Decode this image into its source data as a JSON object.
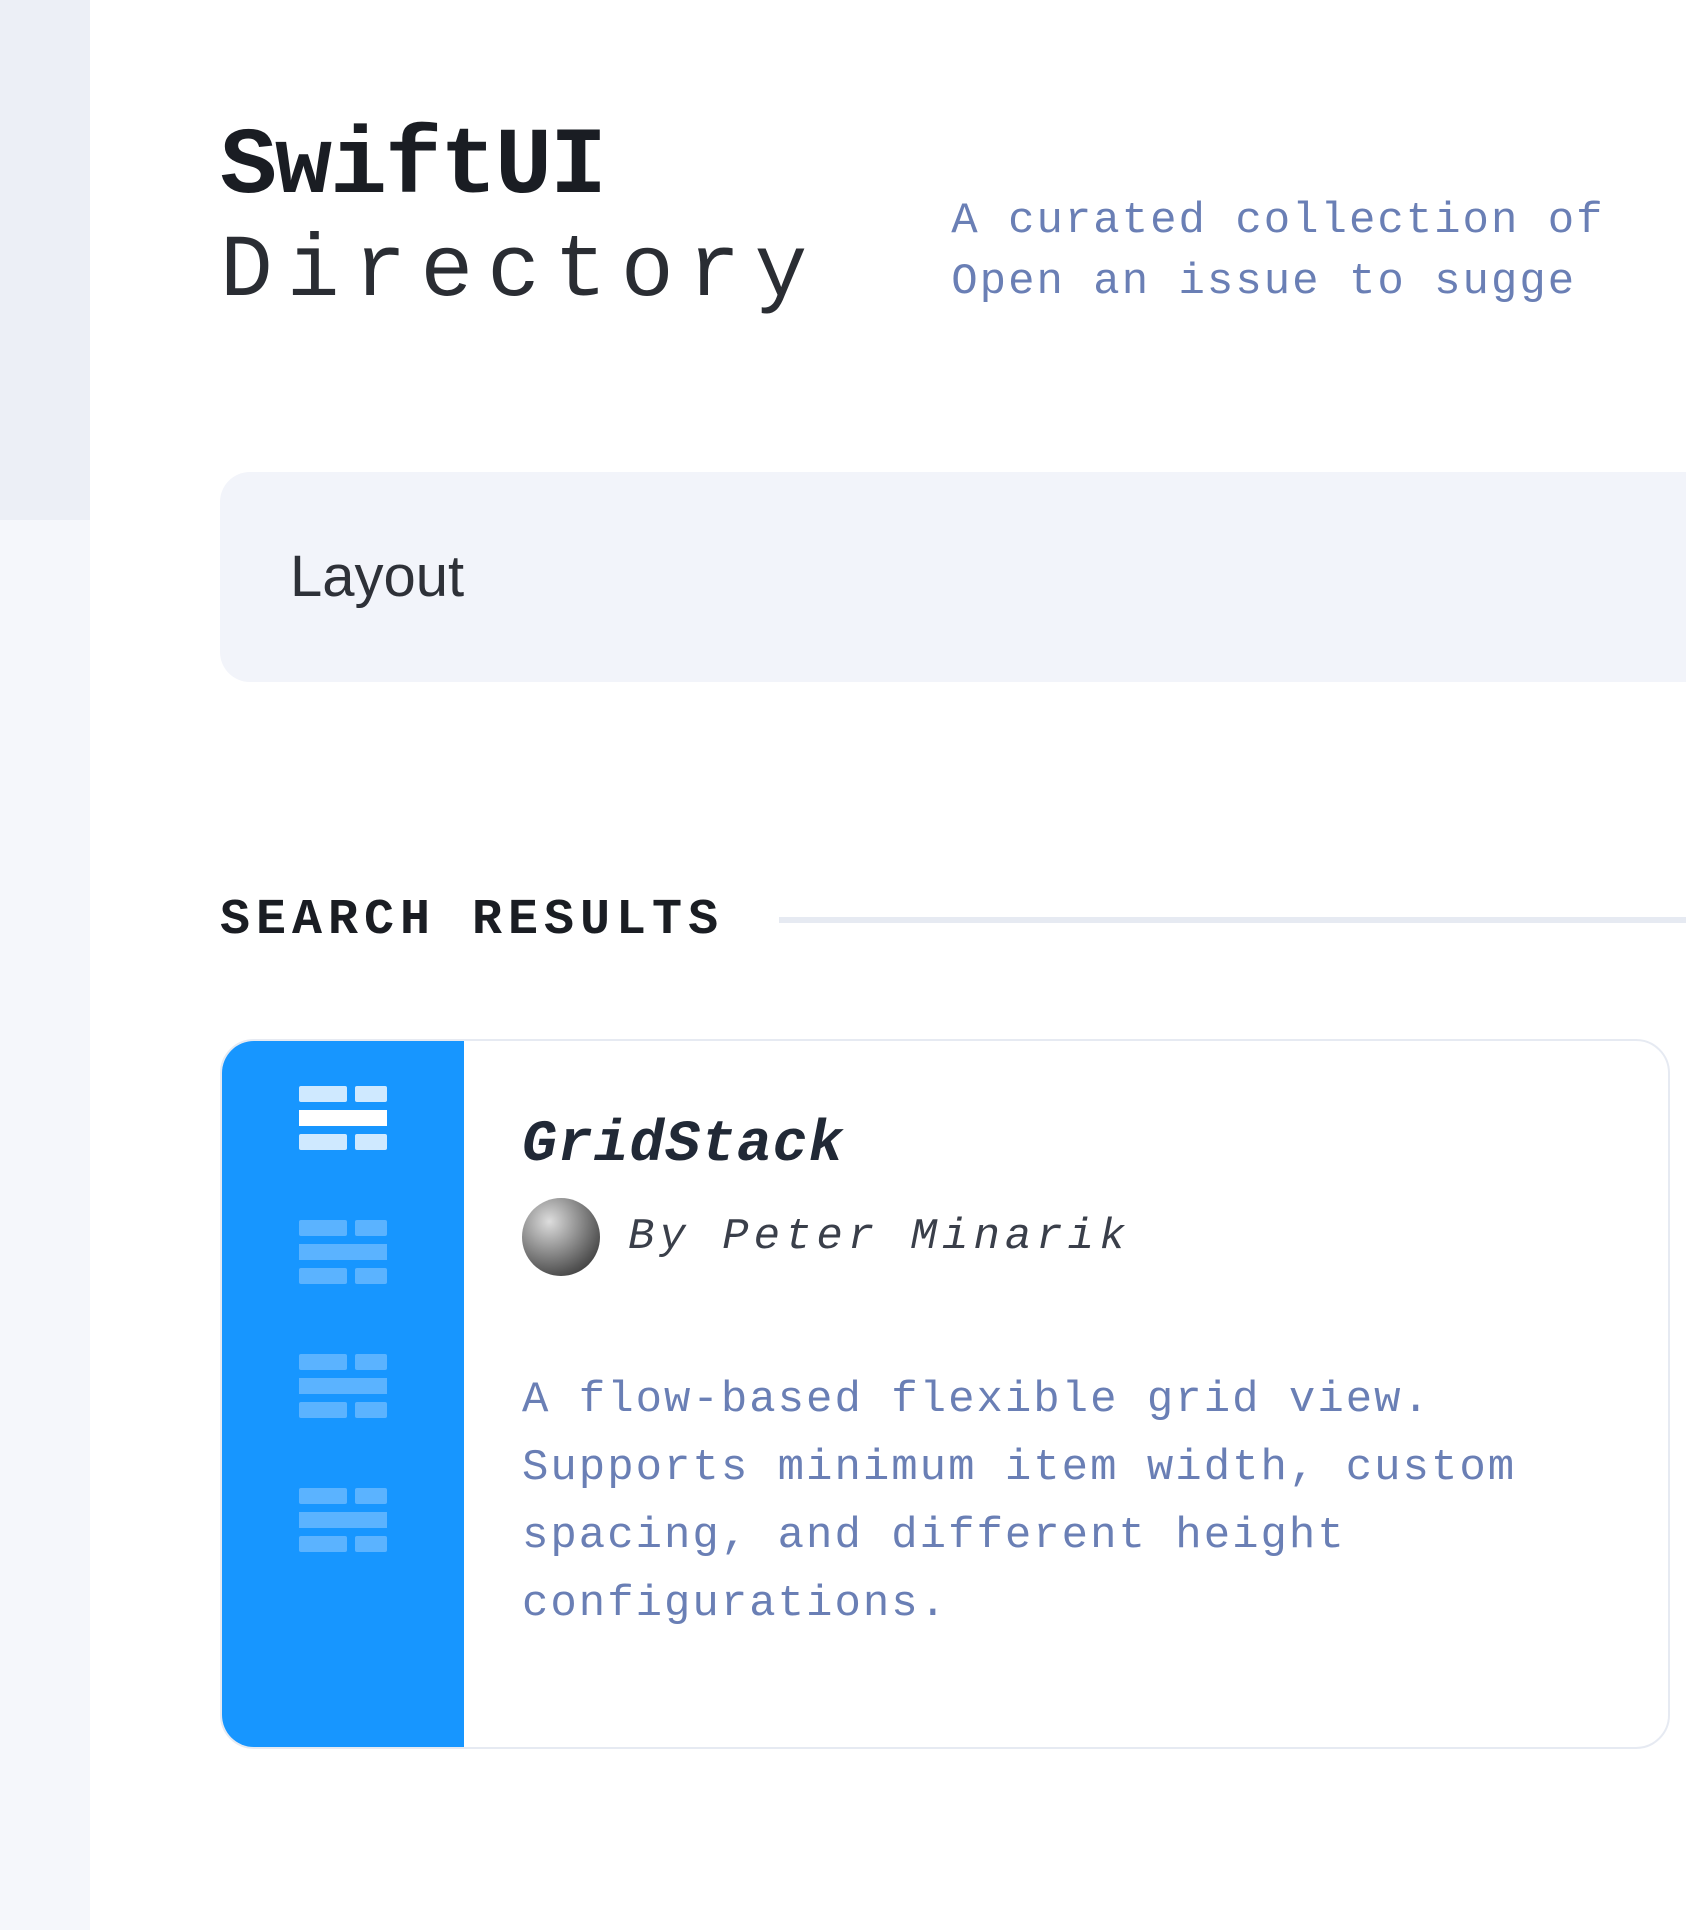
{
  "header": {
    "title": "SwiftUI",
    "subtitle": "Directory",
    "tagline_line1": "A curated collection of",
    "tagline_line2": "Open an issue to sugge"
  },
  "search": {
    "value": "Layout",
    "placeholder": ""
  },
  "section": {
    "title": "SEARCH RESULTS"
  },
  "results": [
    {
      "title": "GridStack",
      "author_prefix": "By",
      "author_name": "Peter Minarik",
      "description": "A flow-based flexible grid view. Supports minimum item width, custom spacing, and different height configurations.",
      "accent_color": "#1796ff"
    }
  ]
}
